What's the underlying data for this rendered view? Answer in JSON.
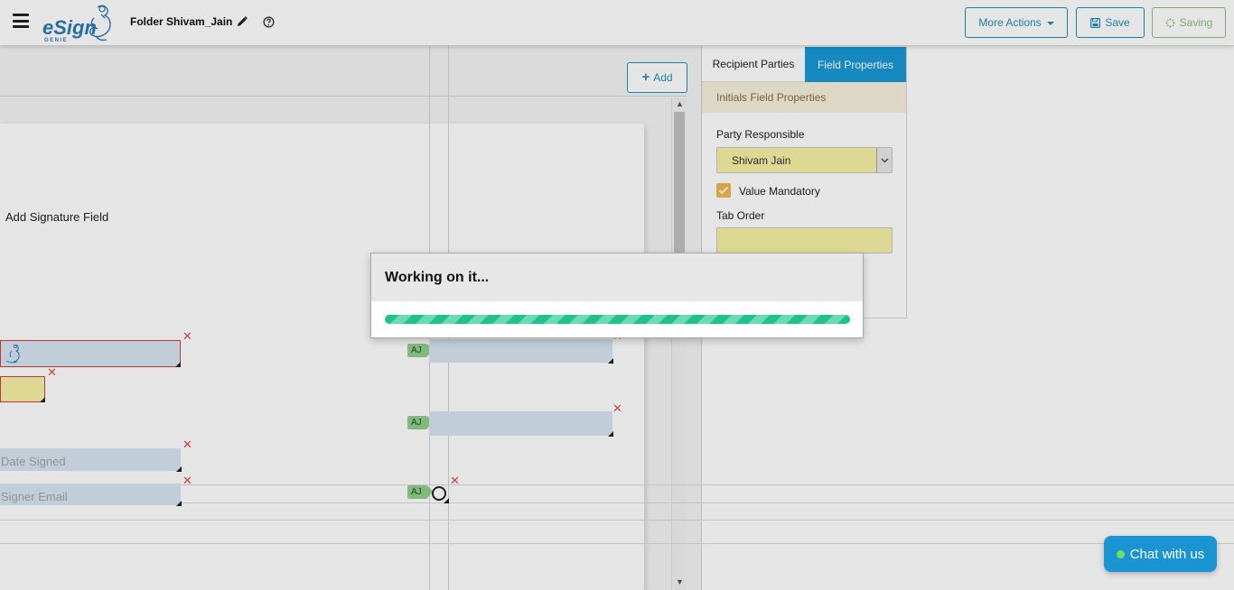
{
  "header": {
    "logo_text": "eSign",
    "logo_sub": "GENIE",
    "folder_title": "Folder Shivam_Jain",
    "more_actions_label": "More Actions",
    "save_label": "Save",
    "saving_label": "Saving"
  },
  "document": {
    "add_button_label": "Add",
    "signature_field_label": "Add Signature Field",
    "date_signed_placeholder": "Date Signed",
    "signer_email_placeholder": "Signer Email",
    "party_tags": [
      "AJ",
      "AJ",
      "AJ"
    ]
  },
  "right_panel": {
    "tabs": [
      {
        "label": "Recipient Parties",
        "active": false
      },
      {
        "label": "Field Properties",
        "active": true
      }
    ],
    "section_title": "Initials Field Properties",
    "party_responsible_label": "Party Responsible",
    "party_responsible_value": "Shivam Jain",
    "value_mandatory_label": "Value Mandatory",
    "value_mandatory_checked": true,
    "tab_order_label": "Tab Order",
    "tab_order_value": ""
  },
  "modal": {
    "title": "Working on it...",
    "progress": 1.0
  },
  "chat": {
    "label": "Chat with us"
  },
  "colors": {
    "accent": "#1f8fbd",
    "tab_active": "#199ad6",
    "progress": "#1fc18d",
    "field_blue": "#d7e6f3",
    "field_yellow": "#f6f2a6",
    "delete_red": "#e04848"
  }
}
